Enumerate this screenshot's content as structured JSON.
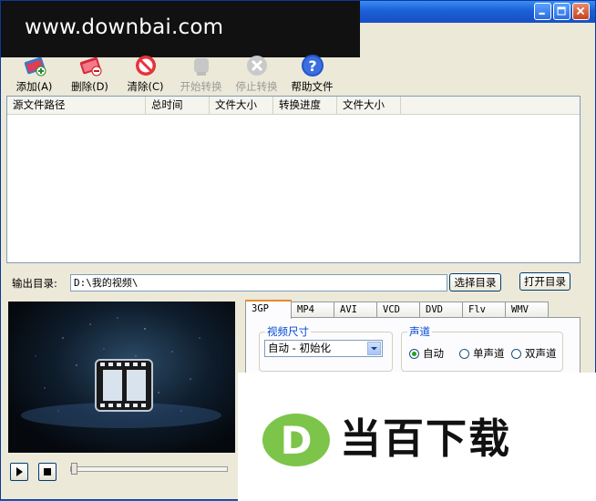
{
  "watermark": {
    "text": "www.downbai.com"
  },
  "toolbar": {
    "items": [
      {
        "label": "添加(A)",
        "icon": "add-video-icon",
        "enabled": true
      },
      {
        "label": "删除(D)",
        "icon": "delete-icon",
        "enabled": true
      },
      {
        "label": "清除(C)",
        "icon": "clear-icon",
        "enabled": true
      },
      {
        "label": "开始转换",
        "icon": "start-convert-icon",
        "enabled": false
      },
      {
        "label": "停止转换",
        "icon": "stop-convert-icon",
        "enabled": false
      },
      {
        "label": "帮助文件",
        "icon": "help-icon",
        "enabled": true
      }
    ]
  },
  "list": {
    "columns": [
      "源文件路径",
      "总时间",
      "文件大小",
      "转换进度",
      "文件大小"
    ],
    "rows": []
  },
  "output": {
    "label": "输出目录:",
    "value": "D:\\我的视频\\",
    "choose_label": "选择目录",
    "open_label": "打开目录"
  },
  "tabs": [
    "3GP",
    "MP4",
    "AVI",
    "VCD",
    "DVD",
    "Flv",
    "WMV"
  ],
  "active_tab": "3GP",
  "video_size": {
    "legend": "视频尺寸",
    "selected": "自动 - 初始化"
  },
  "channel": {
    "legend": "声道",
    "options": [
      "自动",
      "单声道",
      "双声道"
    ],
    "selected": "自动"
  },
  "brand": {
    "text": "当百下载",
    "logo_letter": "D",
    "logo_color": "#7cc54a"
  },
  "colors": {
    "titlebar": "#1c5fd6",
    "window": "#ece9d8",
    "tab_active_accent": "#e68b2c"
  }
}
